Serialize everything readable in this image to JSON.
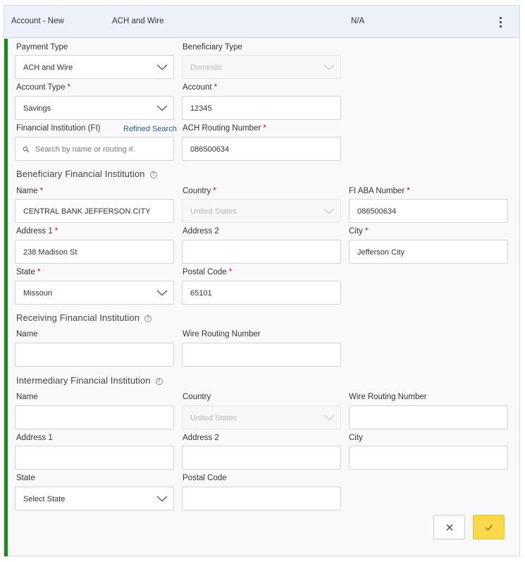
{
  "header": {
    "account_status": "Account - New",
    "payment_type": "ACH and Wire",
    "value": "N/A"
  },
  "payment_type": {
    "label": "Payment Type",
    "value": "ACH and Wire"
  },
  "beneficiary_type": {
    "label": "Beneficiary Type",
    "value": "Domestic"
  },
  "account_type": {
    "label": "Account Type",
    "value": "Savings"
  },
  "account": {
    "label": "Account",
    "value": "12345"
  },
  "financial_institution": {
    "label": "Financial Institution (FI)",
    "refined_search": "Refined Search",
    "placeholder": "Search by name or routing #."
  },
  "ach_routing": {
    "label": "ACH Routing Number",
    "value": "086500634"
  },
  "beneficiary_fi": {
    "title": "Beneficiary Financial Institution",
    "name": {
      "label": "Name",
      "value": "CENTRAL BANK JEFFERSON CITY"
    },
    "country": {
      "label": "Country",
      "value": "United States"
    },
    "aba": {
      "label": "FI ABA Number",
      "value": "086500634"
    },
    "address1": {
      "label": "Address 1",
      "value": "238 Madison St"
    },
    "address2": {
      "label": "Address 2",
      "value": ""
    },
    "city": {
      "label": "City",
      "value": "Jefferson City"
    },
    "state": {
      "label": "State",
      "value": "Missouri"
    },
    "postal": {
      "label": "Postal Code",
      "value": "65101"
    }
  },
  "receiving_fi": {
    "title": "Receiving Financial Institution",
    "name": {
      "label": "Name",
      "value": ""
    },
    "wire_routing": {
      "label": "Wire Routing Number",
      "value": ""
    }
  },
  "intermediary_fi": {
    "title": "Intermediary Financial Institution",
    "name": {
      "label": "Name",
      "value": ""
    },
    "country": {
      "label": "Country",
      "value": "United States"
    },
    "wire_routing": {
      "label": "Wire Routing Number",
      "value": ""
    },
    "address1": {
      "label": "Address 1",
      "value": ""
    },
    "address2": {
      "label": "Address 2",
      "value": ""
    },
    "city": {
      "label": "City",
      "value": ""
    },
    "state": {
      "label": "State",
      "value": "Select State"
    },
    "postal": {
      "label": "Postal Code",
      "value": ""
    }
  },
  "required_marker": "*",
  "help_glyph": "?",
  "colors": {
    "accent": "#1e8a1e",
    "save_button": "#f9d949",
    "required": "#d0021b",
    "header_bg": "#edf2fa"
  }
}
